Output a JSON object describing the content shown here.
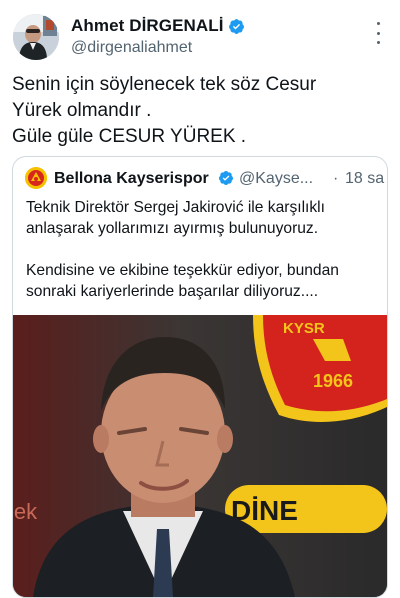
{
  "author": {
    "display_name": "Ahmet DİRGENALİ",
    "handle": "@dirgenaliahmet"
  },
  "tweet": {
    "lines": [
      "Senin için söylenecek tek söz Cesur",
      "Yürek olmandır .",
      "Güle güle CESUR YÜREK ."
    ]
  },
  "quoted": {
    "display_name": "Bellona Kayserispor",
    "handle": "@Kayse...",
    "separator": "·",
    "time": "18 sa",
    "paragraph1": [
      "Teknik Direktör Sergej Jakirović ile karşılıklı",
      "anlaşarak yollarımızı ayırmış bulunuyoruz."
    ],
    "paragraph2": [
      "Kendisine ve ekibine teşekkür ediyor, bundan",
      "sonraki kariyerlerinde başarılar diliyoruz...."
    ],
    "image": {
      "logo_text": "KYSR",
      "logo_year": "1966",
      "sponsor_left": "lek",
      "sponsor_right": "DİNE"
    }
  },
  "colors": {
    "verified_blue": "#1d9bf0",
    "text_primary": "#0f1419",
    "text_secondary": "#536471",
    "border": "#cfd9de"
  },
  "icons": {
    "verified": "verified-badge-icon",
    "more": "more-options-icon"
  }
}
